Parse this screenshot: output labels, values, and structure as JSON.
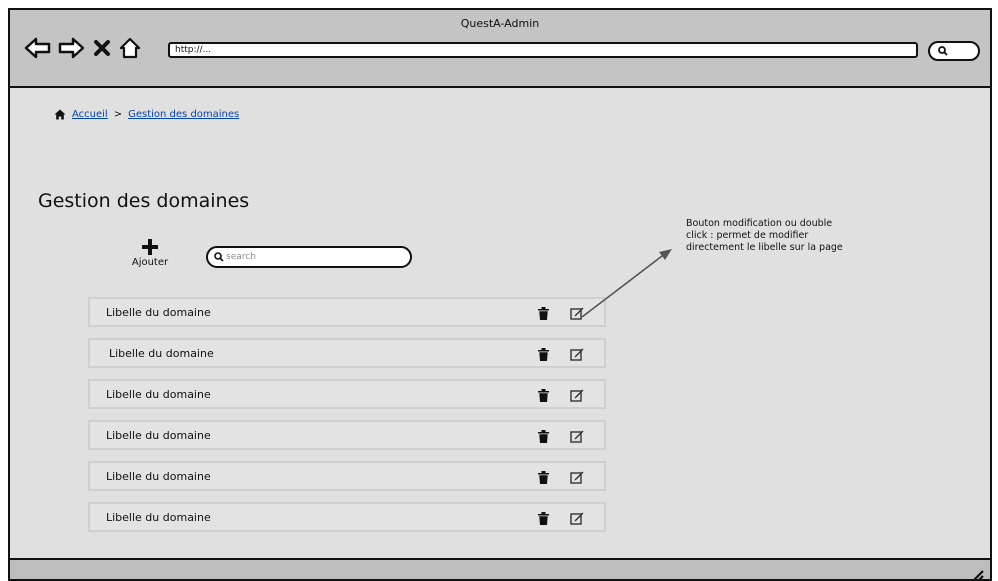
{
  "window": {
    "title": "QuestA-Admin",
    "url": "http://..."
  },
  "nav": {
    "back_icon": "arrow-left-icon",
    "forward_icon": "arrow-right-icon",
    "stop_icon": "x-icon",
    "home_icon": "home-icon"
  },
  "breadcrumb": {
    "home": "Accueil",
    "separator": ">",
    "current": "Gestion des domaines"
  },
  "page": {
    "title": "Gestion des domaines"
  },
  "toolbar": {
    "add_label": "Ajouter",
    "search_placeholder": "search"
  },
  "domains": [
    {
      "label": "Libelle du domaine"
    },
    {
      "label": "Libelle du domaine"
    },
    {
      "label": "Libelle du domaine"
    },
    {
      "label": "Libelle du domaine"
    },
    {
      "label": "Libelle du domaine"
    },
    {
      "label": "Libelle du domaine"
    }
  ],
  "annotation": {
    "text": "Bouton modification ou double click : permet de modifier directement le libelle sur la page"
  }
}
